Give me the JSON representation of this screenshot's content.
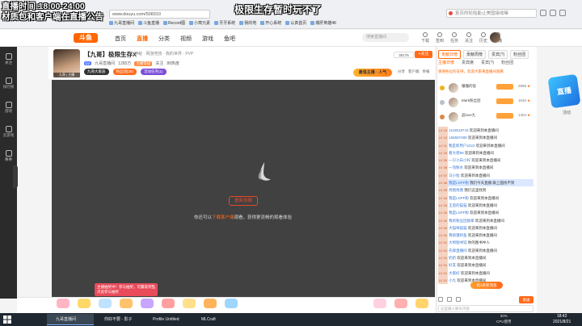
{
  "overlay": {
    "line1": "直播时间:18:00-24:00",
    "line2": "材质包和客户端在直播公告",
    "center": "极限生存暂时玩不了"
  },
  "browser": {
    "url": "www.douyu.com/508310",
    "search_placeholder": "复苏的轮船能让美国接收嘛",
    "bookmarks": [
      "九哥直播间",
      "斗鱼直播",
      "Record图",
      "小窝元素",
      "牙牙系统",
      "我的地",
      "开心系统",
      "认真首页",
      "爆肝英雄4K"
    ]
  },
  "site": {
    "logo": "斗鱼",
    "nav": [
      "首页",
      "直播",
      "分类",
      "视频",
      "游戏",
      "鱼吧"
    ],
    "nav_active": "直播",
    "search_placeholder": "搜索直播间",
    "header_icons": [
      "下载",
      "签到",
      "任务",
      "关注",
      "历史",
      "开播"
    ]
  },
  "left_sidebar": {
    "items": [
      "关注",
      "排行榜",
      "游戏",
      "云游戏",
      "赛事"
    ]
  },
  "anchor": {
    "av_tag": "九哥 | 主播",
    "title": "【九哥】极限生存X",
    "sub": "神秘 · 网游竞技 · 我的世界 · PVP",
    "level": "LV",
    "meta": [
      "九哥直播间",
      "1285万",
      "主播等级",
      "关注",
      "88热度"
    ],
    "buttons": [
      "九哥大家族",
      "粉丝团(26)",
      "活动任务(1)"
    ],
    "follow_count": "30175",
    "follow_label": "+关注",
    "promo": "最强主播 · 人气",
    "tools": [
      "分享",
      "客户端",
      "举报"
    ]
  },
  "video": {
    "retry": "重新加载",
    "hint_pre": "你还可以",
    "hint_link": "下载客户端",
    "hint_post": "观看，获得更流畅的观看体验",
    "popup": "主播抽奖中！参与抽奖，可赢取奖品 点此参与抽奖"
  },
  "right_panel": {
    "tabs1": [
      "贡献日榜",
      "贡献周榜",
      "贵宾(?)",
      "粉丝团"
    ],
    "tabs2": [
      "主播日榜",
      "贵宾席",
      "贵宾(?)",
      "粉丝团"
    ],
    "notice": "感谢各位的支持，欢迎大家来直播间观看",
    "rank": [
      {
        "name": "懂懂的饭",
        "value": "2968",
        "crown": "#f2b21a"
      },
      {
        "name": "Mark粉丝团",
        "value": "1540",
        "crown": "#b8c0cc"
      },
      {
        "name": "品love九",
        "value": "1404",
        "crown": "#d9884a"
      }
    ],
    "deco": "直播",
    "deco_label": "活动",
    "chat": [
      {
        "lv": "LV 13",
        "name": "1118519743",
        "text": "欢迎来到本直播间"
      },
      {
        "lv": "LV 12",
        "name": "156587489",
        "text": "欢迎来到本直播间"
      },
      {
        "lv": "LV 11",
        "name": "我是新用户2222",
        "text": "欢迎来到本直播间"
      },
      {
        "lv": "LV 10",
        "name": "看大佬99",
        "text": "欢迎来到本直播间"
      },
      {
        "lv": "LV 09",
        "name": "一只小白小柠",
        "text": "欢迎来到本直播间"
      },
      {
        "lv": "LV 08",
        "name": "一泡粉水",
        "text": "欢迎来到本直播间"
      },
      {
        "lv": "LV 07",
        "name": "马小粒",
        "text": "欢迎来到本直播间"
      },
      {
        "lv": "LV 06",
        "name": "我是LSPF粉",
        "text": "我们今天直播 跟上面找不到",
        "hl": true
      },
      {
        "lv": "LV 05",
        "name": "周围找我",
        "text": "我们这里找到"
      },
      {
        "lv": "LV 04",
        "name": "我是LSPF粉",
        "text": "欢迎来到本直播间"
      },
      {
        "lv": "LV 03",
        "name": "王后的猫猫",
        "text": "欢迎来到本直播间"
      },
      {
        "lv": "LV 03",
        "name": "我是LSPF粉",
        "text": "欢迎来到本直播间"
      },
      {
        "lv": "LV 02",
        "name": "我的粉丝团勋章",
        "text": "欢迎来到本直播间"
      },
      {
        "lv": "LV 02",
        "name": "大猫咪猫猫",
        "text": "欢迎来到本直播间"
      },
      {
        "lv": "LV 01",
        "name": "我很饿的鱼",
        "text": "欢迎来到本直播间"
      },
      {
        "lv": "LV 01",
        "name": "大师图书馆",
        "text": "你的图书中人"
      },
      {
        "lv": "LV 01",
        "name": "先锋直播间",
        "text": "欢迎来到本直播间"
      },
      {
        "lv": "LV 01",
        "name": "奶奶",
        "text": "欢迎来到本直播间"
      },
      {
        "lv": "LV 01",
        "name": "好友",
        "text": "欢迎来到本直播间"
      },
      {
        "lv": "LV 01",
        "name": "大家好",
        "text": "欢迎来到本直播间"
      },
      {
        "lv": "LV 01",
        "name": "小九",
        "text": "欢迎来到本直播间"
      }
    ],
    "orange_pill": "有1条新消息",
    "input_placeholder": "这里输入聊天内容",
    "send": "发送"
  },
  "taskbar": {
    "items": [
      "九哥直播间",
      "你好不要 - 影子",
      "Profile Untitled",
      "MLCraft"
    ],
    "tray_top": "30%",
    "tray_bottom": "CPU使用",
    "time": "18:42",
    "date": "2021/8/21"
  },
  "colors": {
    "accent": "#ff6a1a",
    "chat_name": "#3778d6"
  }
}
